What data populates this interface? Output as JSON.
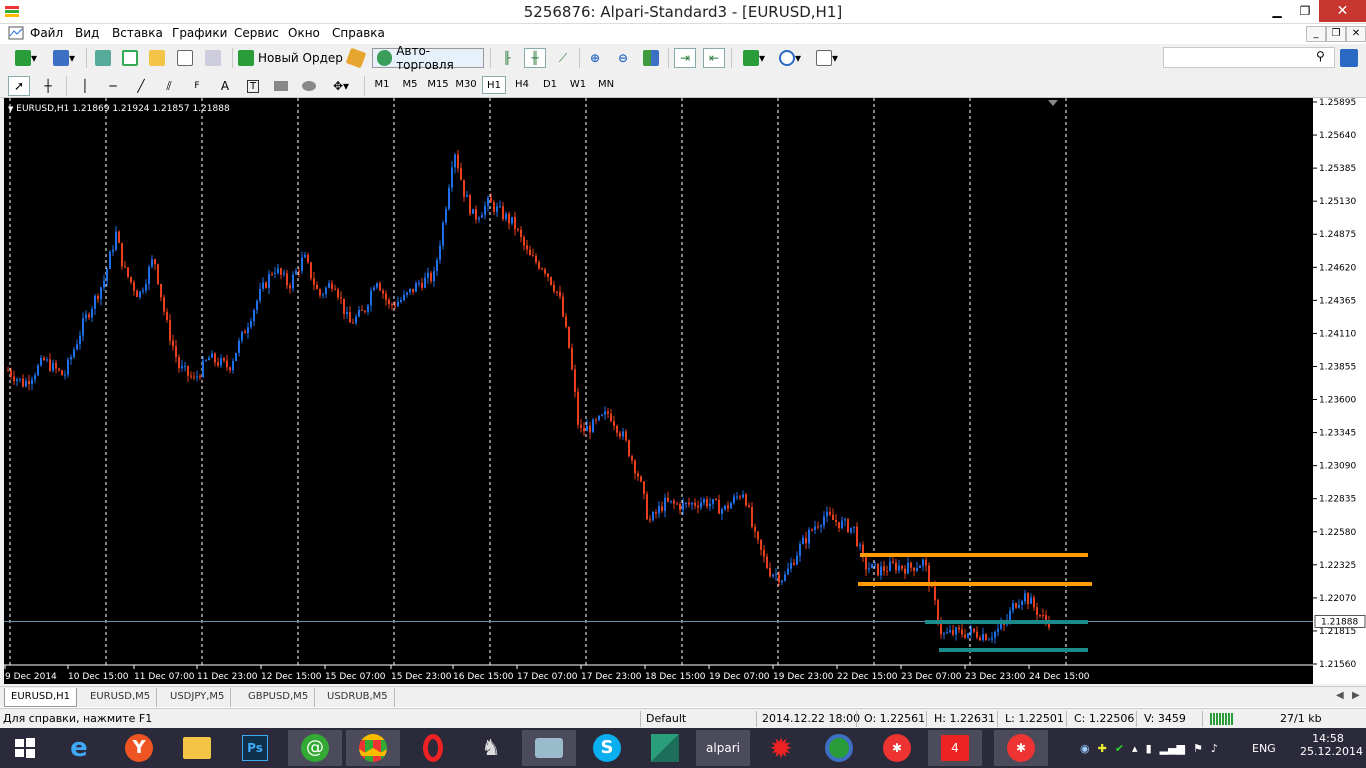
{
  "window": {
    "title": "5256876: Alpari-Standard3 - [EURUSD,H1]",
    "minimize": "▁",
    "restore": "❐",
    "close": "✕"
  },
  "menu": [
    "Файл",
    "Вид",
    "Вставка",
    "Графики",
    "Сервис",
    "Окно",
    "Справка"
  ],
  "mdi": {
    "minimize": "_",
    "restore": "❐",
    "close": "✕"
  },
  "toolbar": {
    "new_order": "Новый Ордер",
    "autotrading": "Авто-торговля"
  },
  "timeframes": [
    "M1",
    "M5",
    "M15",
    "M30",
    "H1",
    "H4",
    "D1",
    "W1",
    "MN"
  ],
  "active_timeframe": "H1",
  "chart": {
    "header": "EURUSD,H1  1.21869 1.21924 1.21857 1.21888",
    "price_labels": [
      "1.25895",
      "1.25640",
      "1.25385",
      "1.25130",
      "1.24875",
      "1.24620",
      "1.24365",
      "1.24110",
      "1.23855",
      "1.23600",
      "1.23345",
      "1.23090",
      "1.22835",
      "1.22580",
      "1.22325",
      "1.22070",
      "1.21815",
      "1.21560"
    ],
    "current_price": "1.21888",
    "date_labels": [
      "9 Dec 2014",
      "10 Dec 15:00",
      "11 Dec 07:00",
      "11 Dec 23:00",
      "12 Dec 15:00",
      "15 Dec 07:00",
      "15 Dec 23:00",
      "16 Dec 15:00",
      "17 Dec 07:00",
      "17 Dec 23:00",
      "18 Dec 15:00",
      "19 Dec 07:00",
      "19 Dec 23:00",
      "22 Dec 15:00",
      "23 Dec 07:00",
      "23 Dec 23:00",
      "24 Dec 15:00"
    ],
    "colors": {
      "bull": "#1e6fe8",
      "bear": "#e8401e",
      "orange": "#ff9a00",
      "teal": "#1a8a8a",
      "bid": "#6a8fa8"
    }
  },
  "tabs": [
    "EURUSD,H1",
    "EURUSD,M5",
    "USDJPY,M5",
    "GBPUSD,M5",
    "USDRUB,M5"
  ],
  "status": {
    "help": "Для справки, нажмите F1",
    "profile": "Default",
    "time": "2014.12.22 18:00",
    "open": "O: 1.22561",
    "high": "H: 1.22631",
    "low": "L: 1.22501",
    "close": "C: 1.22506",
    "volume": "V: 3459",
    "traffic": "27/1 kb"
  },
  "taskbar": {
    "apps": [
      "windows-start",
      "internet-explorer",
      "yandex-browser",
      "file-explorer",
      "photoshop",
      "icq",
      "chrome",
      "opera",
      "counter-strike",
      "keyboard-app",
      "skype",
      "app-green",
      "alpari",
      "torrent-app",
      "download-manager",
      "app-red-1",
      "app-red-2",
      "app-red-3"
    ],
    "alpari_label": "alpari",
    "lang": "ENG",
    "time": "14:58",
    "date": "25.12.2014"
  }
}
